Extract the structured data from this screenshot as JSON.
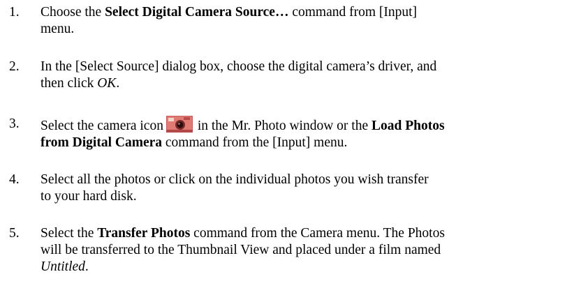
{
  "steps": [
    {
      "number": "1.",
      "line1": {
        "a": "Choose the ",
        "b": "Select Digital Camera Source…",
        "c": " command from [Input]"
      },
      "line2": "menu."
    },
    {
      "number": "2.",
      "line1": "In the [Select Source] dialog box, choose the digital camera’s driver, and",
      "line2": {
        "a": "then click ",
        "b": "OK",
        "c": "."
      }
    },
    {
      "number": "3.",
      "line1": {
        "a": "Select the camera icon",
        "b": " in the Mr. Photo window or the ",
        "c": "Load Photos"
      },
      "line2": {
        "a": "from Digital Camera",
        "b": " command from the [Input] menu."
      }
    },
    {
      "number": "4.",
      "line1": "Select all the photos or click on the individual photos you wish transfer",
      "line2": "to your hard disk."
    },
    {
      "number": "5.",
      "line1": {
        "a": "Select the ",
        "b": "Transfer Photos",
        "c": " command from the Camera menu.  The Photos"
      },
      "line2": "will be transferred to the Thumbnail View and placed under a film named",
      "line3": {
        "a": "Untitled",
        "b": "."
      }
    }
  ],
  "icons": {
    "camera": "camera-icon",
    "camera_color": "#d96a6a"
  }
}
